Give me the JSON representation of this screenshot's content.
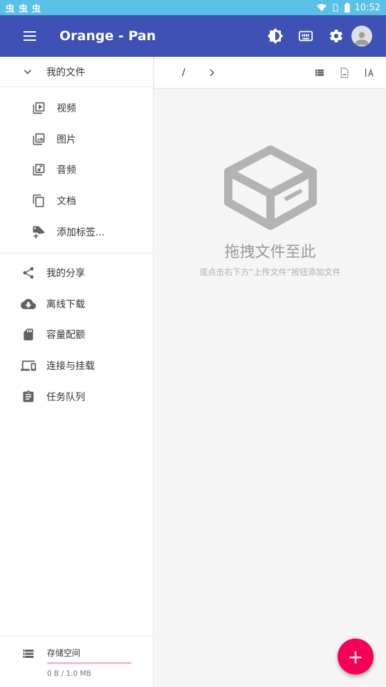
{
  "status_bar": {
    "left_icons": [
      "虫",
      "虫",
      "虫"
    ],
    "time": "10:52"
  },
  "app_bar": {
    "title": "Orange - Pan"
  },
  "sidebar": {
    "header": "我的文件",
    "sub_items": [
      {
        "label": "视频",
        "icon": "video-icon"
      },
      {
        "label": "图片",
        "icon": "image-icon"
      },
      {
        "label": "音频",
        "icon": "music-icon"
      },
      {
        "label": "文档",
        "icon": "document-icon"
      },
      {
        "label": "添加标签...",
        "icon": "add-tag-icon"
      }
    ],
    "items": [
      {
        "label": "我的分享",
        "icon": "share-icon"
      },
      {
        "label": "离线下载",
        "icon": "cloud-download-icon"
      },
      {
        "label": "容量配额",
        "icon": "sd-card-icon"
      },
      {
        "label": "连接与挂载",
        "icon": "devices-icon"
      },
      {
        "label": "任务队列",
        "icon": "assignment-icon"
      }
    ],
    "storage": {
      "title": "存储空间",
      "usage": "0 B / 1.0 MB",
      "fraction": 0
    }
  },
  "main": {
    "breadcrumb": "/",
    "empty_title": "拖拽文件至此",
    "empty_hint": "或点击右下方“上传文件”按钮添加文件"
  },
  "fab": {
    "label": "+"
  },
  "colors": {
    "primary": "#3f51b5",
    "accent": "#f50057",
    "status_bar": "#5ac0e6"
  }
}
